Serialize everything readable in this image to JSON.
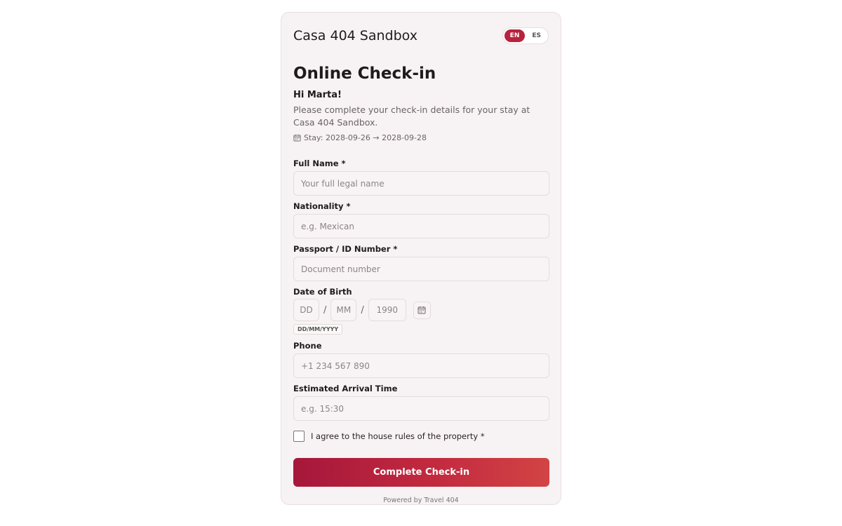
{
  "header": {
    "property_name": "Casa 404 Sandbox",
    "languages": [
      {
        "code": "EN",
        "active": true
      },
      {
        "code": "ES",
        "active": false
      }
    ]
  },
  "title": "Online Check-in",
  "greeting": "Hi Marta!",
  "intro": "Please complete your check-in details for your stay at Casa 404 Sandbox.",
  "stay": {
    "icon": "calendar-icon",
    "text": "Stay: 2028-09-26 → 2028-09-28"
  },
  "form": {
    "full_name": {
      "label": "Full Name *",
      "placeholder": "Your full legal name",
      "value": ""
    },
    "nationality": {
      "label": "Nationality *",
      "placeholder": "e.g. Mexican",
      "value": ""
    },
    "passport": {
      "label": "Passport / ID Number *",
      "placeholder": "Document number",
      "value": ""
    },
    "dob": {
      "label": "Date of Birth",
      "day_placeholder": "DD",
      "month_placeholder": "MM",
      "year_placeholder": "1990",
      "separator": "/",
      "format_hint": "DD/MM/YYYY"
    },
    "phone": {
      "label": "Phone",
      "placeholder": "+1 234 567 890",
      "value": ""
    },
    "arrival": {
      "label": "Estimated Arrival Time",
      "placeholder": "e.g. 15:30",
      "value": ""
    },
    "agree_label": "I agree to the house rules of the property *",
    "agree_checked": false
  },
  "submit_label": "Complete Check-in",
  "footer": "Powered by Travel 404",
  "colors": {
    "accent": "#b7223d",
    "card_bg": "#f7f2f3",
    "button_gradient_start": "#a6173b",
    "button_gradient_end": "#d24444"
  }
}
